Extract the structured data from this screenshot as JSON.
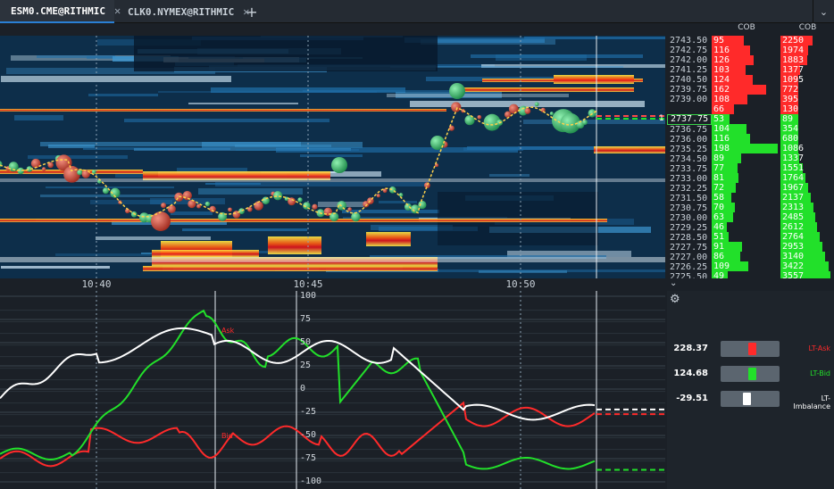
{
  "tabs": [
    {
      "label": "ESM0.CME@RITHMIC",
      "active": true,
      "close": "✕"
    },
    {
      "label": "CLK0.NYMEX@RITHMIC",
      "active": false,
      "close": "✕"
    }
  ],
  "tab_add": "+",
  "tab_menu": "⌄",
  "time_axis": [
    "10:40",
    "10:45",
    "10:50"
  ],
  "cob": {
    "headers": [
      "COB",
      "COB"
    ],
    "marker": "1"
  },
  "ladder": {
    "prices": [
      "2743.50",
      "2742.75",
      "2742.00",
      "2741.25",
      "2740.50",
      "2739.75",
      "2739.00",
      "",
      "2737.75",
      "2736.75",
      "2736.00",
      "2735.25",
      "2734.50",
      "2733.75",
      "2733.00",
      "2732.25",
      "2731.50",
      "2730.75",
      "2730.00",
      "2729.25",
      "2728.50",
      "2727.75",
      "2727.00",
      "2726.25",
      "2725.50",
      "2724.75"
    ],
    "current_index": 8,
    "cob_left": [
      "95",
      "116",
      "126",
      "103",
      "124",
      "162",
      "108",
      "66",
      "53",
      "104",
      "116",
      "198",
      "89",
      "77",
      "81",
      "72",
      "58",
      "70",
      "63",
      "46",
      "51",
      "91",
      "86",
      "109",
      "49",
      "74"
    ],
    "cob_right": [
      "2250",
      "1974",
      "1883",
      "1377",
      "1095",
      "772",
      "395",
      "130",
      "89",
      "354",
      "680",
      "1086",
      "1337",
      "1551",
      "1764",
      "1967",
      "2137",
      "2313",
      "2485",
      "2612",
      "2764",
      "2953",
      "3140",
      "3422",
      "3557",
      "3658"
    ]
  },
  "oscillator": {
    "y_ticks": [
      "100",
      "75",
      "50",
      "25",
      "0",
      "-25",
      "-50",
      "-75",
      "-100"
    ],
    "inline_labels": [
      "Ask",
      "Bid"
    ]
  },
  "indicators": [
    {
      "value": "228.37",
      "label": "LT-Ask",
      "color": "#ff2a2a",
      "level": 0.55
    },
    {
      "value": "124.68",
      "label": "LT-Bid",
      "color": "#22e02a",
      "level": 0.55
    },
    {
      "value": "-29.51",
      "label": "LT-Imbalance",
      "color": "#ffffff",
      "level": 0.43
    }
  ],
  "settings_icon": "⚙",
  "collapse_icon": "⌄",
  "colors": {
    "ask": "#ff2a2a",
    "bid": "#22e02a",
    "imbalance": "#ffffff",
    "accent": "#2a7fd4"
  }
}
